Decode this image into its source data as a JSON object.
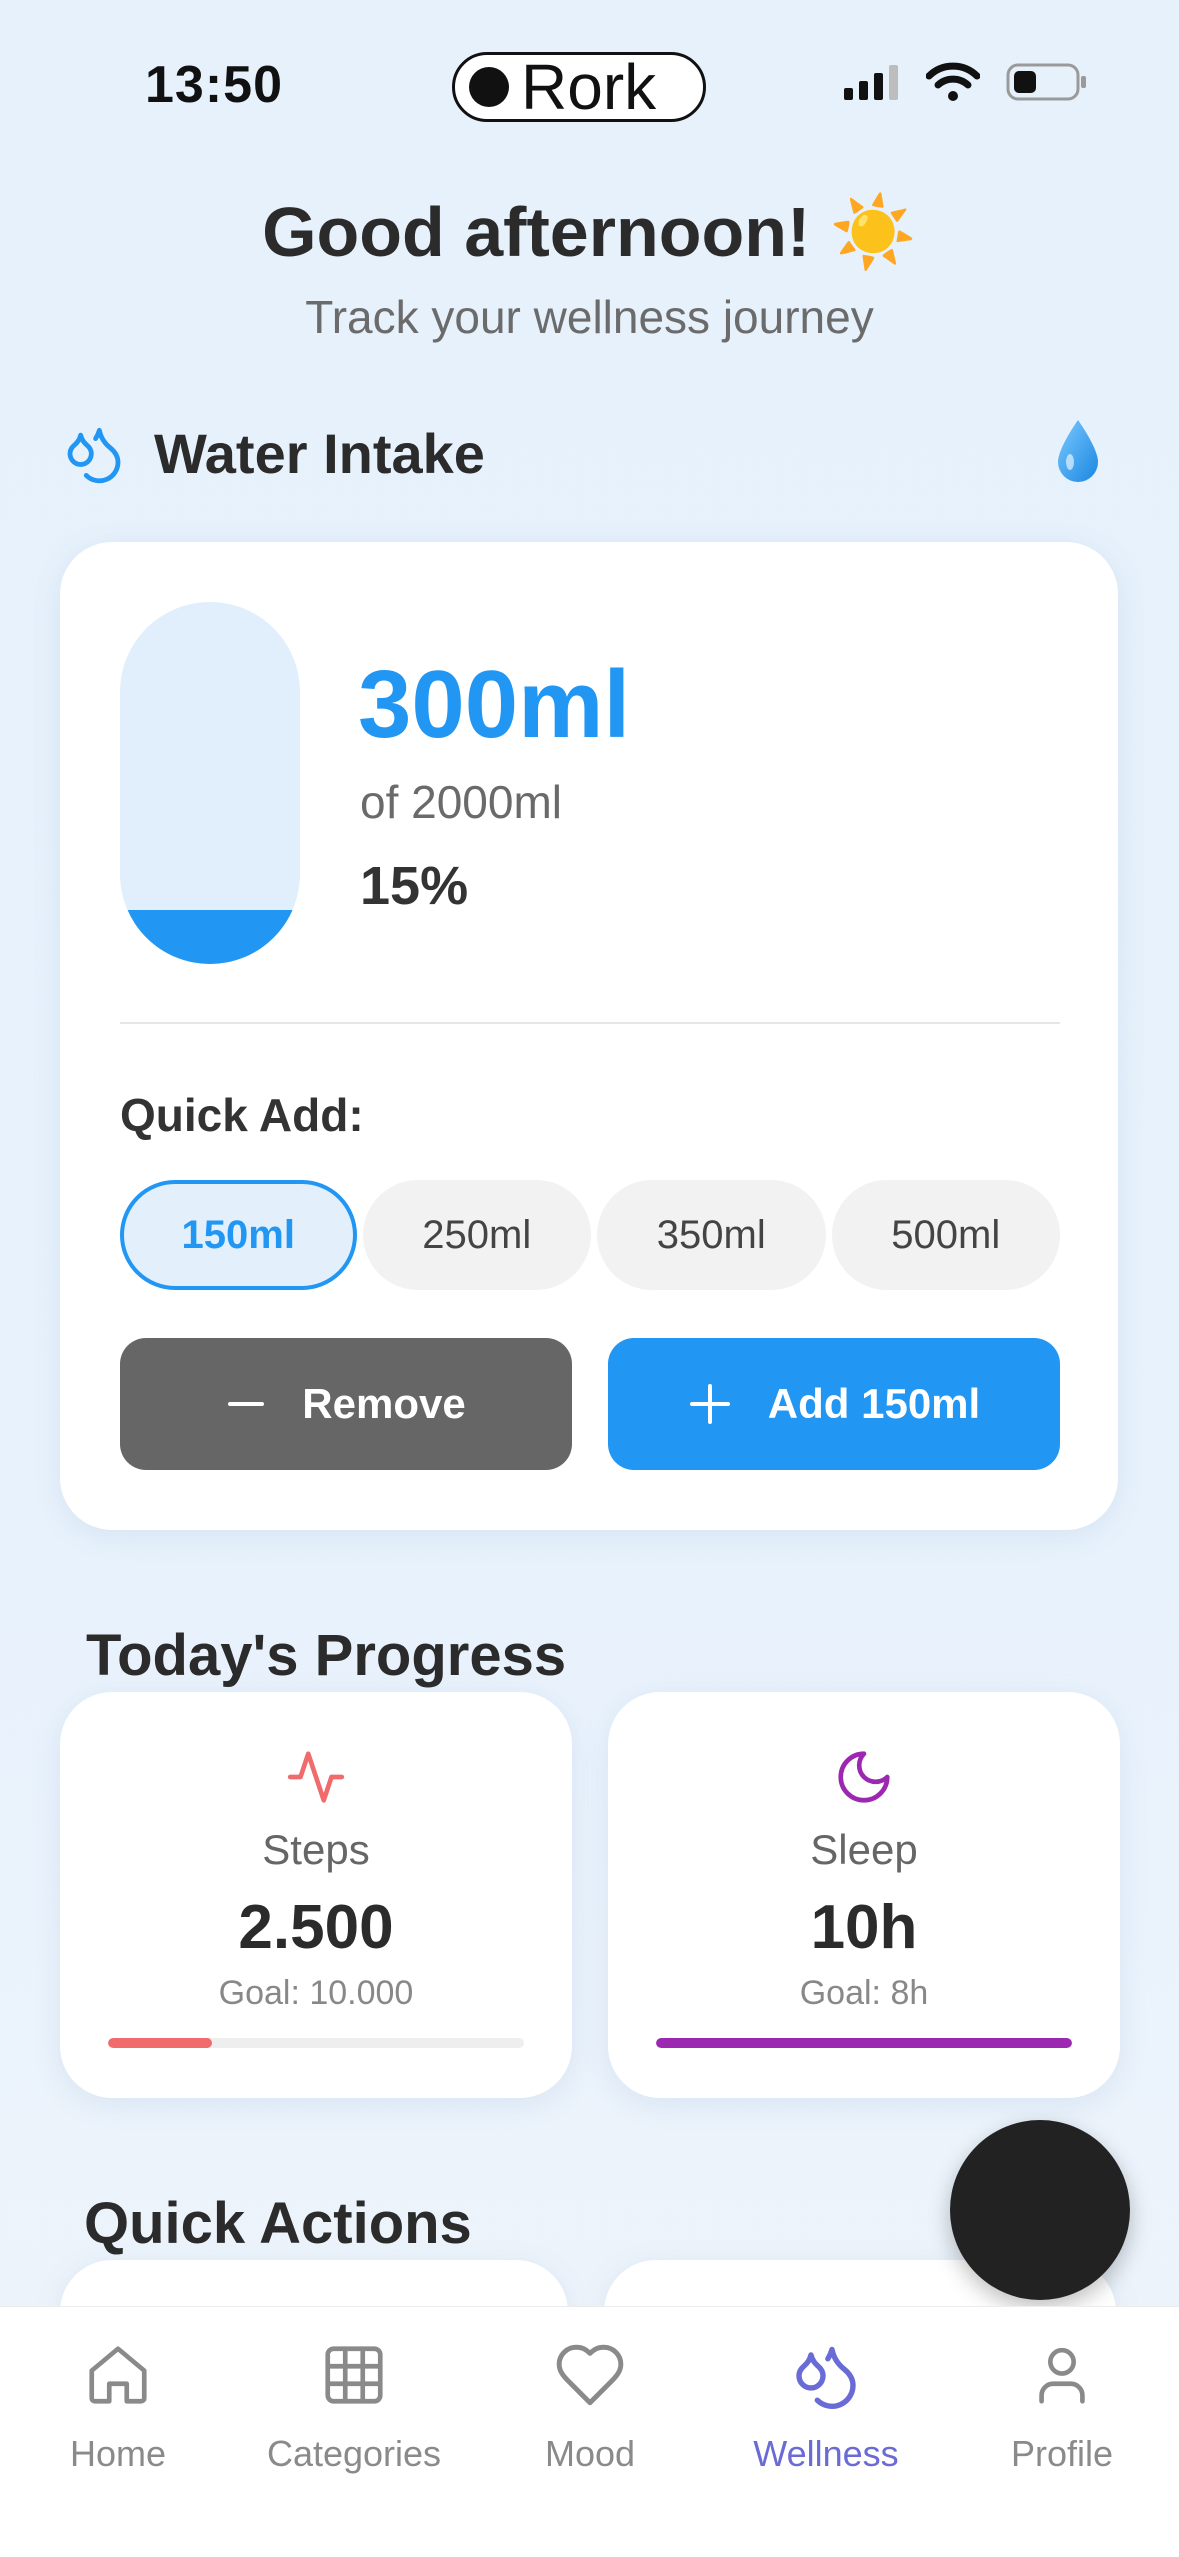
{
  "status_bar": {
    "time": "13:50",
    "app_pill": "Rork"
  },
  "header": {
    "greeting": "Good afternoon! ☀️",
    "subtitle": "Track your wellness journey"
  },
  "water": {
    "title": "Water Intake",
    "current": "300ml",
    "goal_text": "of 2000ml",
    "percent_text": "15%",
    "fill_fraction": 0.15,
    "quick_add_label": "Quick Add:",
    "options": [
      "150ml",
      "250ml",
      "350ml",
      "500ml"
    ],
    "selected_option": "150ml",
    "remove_label": "Remove",
    "add_label": "Add 150ml",
    "accent": "#2196f3"
  },
  "progress": {
    "title": "Today's Progress",
    "steps": {
      "label": "Steps",
      "value": "2.500",
      "goal": "Goal: 10.000",
      "fraction": 0.25,
      "color": "#f06b6b"
    },
    "sleep": {
      "label": "Sleep",
      "value": "10h",
      "goal": "Goal: 8h",
      "fraction": 1.0,
      "color": "#9c27b0"
    }
  },
  "quick_actions": {
    "title": "Quick Actions"
  },
  "tabs": [
    {
      "label": "Home",
      "icon": "home-icon"
    },
    {
      "label": "Categories",
      "icon": "grid-icon"
    },
    {
      "label": "Mood",
      "icon": "heart-icon"
    },
    {
      "label": "Wellness",
      "icon": "droplets-icon",
      "active": true
    },
    {
      "label": "Profile",
      "icon": "user-icon"
    }
  ]
}
